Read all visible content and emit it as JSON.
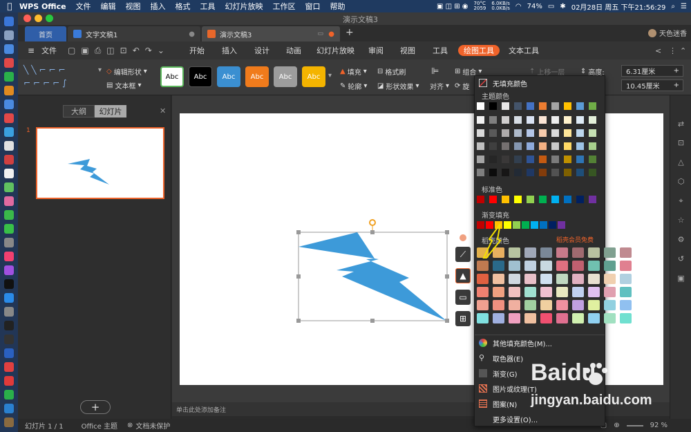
{
  "mac_menubar": {
    "app_name": "WPS Office",
    "items": [
      "文件",
      "编辑",
      "视图",
      "插入",
      "格式",
      "工具",
      "幻灯片放映",
      "工作区",
      "窗口",
      "帮助"
    ],
    "cpu_temp": "70°C",
    "cpu_freq": "2059",
    "net_up": "6.0KB/s",
    "net_down": "0.0KB/s",
    "datetime": "02月28日 周五 下午21:56:29",
    "battery": "74%"
  },
  "window": {
    "title": "演示文稿3",
    "tabs": [
      {
        "label": "首页"
      },
      {
        "label": "文字文稿1"
      },
      {
        "label": "演示文稿3"
      }
    ],
    "add_tab": "+",
    "user_name": "天色迷香"
  },
  "menu_row": {
    "file_label": "文件",
    "tabs": [
      "开始",
      "插入",
      "设计",
      "动画",
      "幻灯片放映",
      "审阅",
      "视图",
      "工具",
      "绘图工具",
      "文本工具"
    ],
    "active_tab": "绘图工具"
  },
  "ribbon": {
    "edit_shape": "编辑形状",
    "text_box": "文本框",
    "style_swatches": [
      {
        "label": "Abc",
        "bg": "#ffffff",
        "fg": "#000000",
        "border": "#5cb85c"
      },
      {
        "label": "Abc",
        "bg": "#000000",
        "fg": "#ffffff",
        "border": "#555555"
      },
      {
        "label": "Abc",
        "bg": "#3b8fd1",
        "fg": "#ffffff",
        "border": "#3b8fd1"
      },
      {
        "label": "Abc",
        "bg": "#f07b1c",
        "fg": "#ffffff",
        "border": "#f07b1c"
      },
      {
        "label": "Abc",
        "bg": "#9d9d9d",
        "fg": "#ffffff",
        "border": "#9d9d9d"
      },
      {
        "label": "Abc",
        "bg": "#f4b400",
        "fg": "#ffffff",
        "border": "#f4b400"
      }
    ],
    "fill": "填充",
    "outline": "轮廓",
    "format_painter": "格式刷",
    "shape_effects": "形状效果",
    "align": "对齐",
    "group": "组合",
    "rotate": "旋",
    "bring_forward": "上移一层",
    "height_label": "高度:",
    "height_value": "6.31厘米",
    "width_value": "10.45厘米"
  },
  "left_panel": {
    "tab_outline": "大纲",
    "tab_slides": "幻灯片",
    "slide_number": "1",
    "add_slide": "+"
  },
  "notes_placeholder": "单击此处添加备注",
  "status_bar": {
    "slide_info": "幻灯片 1 / 1",
    "theme": "Office 主题",
    "protection": "文档未保护",
    "zoom": "92 %"
  },
  "fill_menu": {
    "no_fill": "无填充颜色",
    "theme_colors_label": "主题颜色",
    "theme_row": [
      "#ffffff",
      "#000000",
      "#e7e6e6",
      "#44546a",
      "#4472c4",
      "#ed7d31",
      "#a5a5a5",
      "#ffc000",
      "#5b9bd5",
      "#70ad47"
    ],
    "theme_shades": [
      [
        "#f2f2f2",
        "#7f7f7f",
        "#d0cece",
        "#d6dce4",
        "#d9e2f3",
        "#fbe5d5",
        "#ededed",
        "#fff2cc",
        "#deebf6",
        "#e2efd9"
      ],
      [
        "#d8d8d8",
        "#595959",
        "#aeabab",
        "#adb9ca",
        "#b4c6e7",
        "#f7cbac",
        "#dbdbdb",
        "#fee599",
        "#bdd7ee",
        "#c5e0b3"
      ],
      [
        "#bfbfbf",
        "#3f3f3f",
        "#757070",
        "#8496b0",
        "#8eaadb",
        "#f4b183",
        "#c9c9c9",
        "#ffd965",
        "#9dc3e6",
        "#a8d08d"
      ],
      [
        "#a5a5a5",
        "#262626",
        "#3a3838",
        "#323f4f",
        "#2f5496",
        "#c55a11",
        "#7b7b7b",
        "#bf9000",
        "#2e75b5",
        "#538135"
      ],
      [
        "#7f7f7f",
        "#0c0c0c",
        "#171616",
        "#222a35",
        "#1f3864",
        "#833c0b",
        "#525252",
        "#7f6000",
        "#1e4e79",
        "#375623"
      ]
    ],
    "standard_colors_label": "标准色",
    "standard_colors": [
      "#c00000",
      "#ff0000",
      "#ffc000",
      "#ffff00",
      "#92d050",
      "#00b050",
      "#00b0f0",
      "#0070c0",
      "#002060",
      "#7030a0"
    ],
    "gradient_label": "渐变填充",
    "gradient_colors": [
      "#c00000",
      "#ff0000",
      "#ffc000",
      "#ffff00",
      "#92d050",
      "#00b050",
      "#00b0f0",
      "#0070c0",
      "#002060",
      "#7030a0"
    ],
    "docer_label": "稻壳颜色",
    "docer_promo": "稻壳会员免费",
    "docer_rows": [
      [
        "#e2b04a",
        "#e8b060",
        "#b7c4a0",
        "#a0a8b8",
        "#7a8898",
        "#c77a8a",
        "#a06a70",
        "#b8c0a0",
        "#80a090",
        "#c08a90"
      ],
      [
        "#c07a50",
        "#2a6a8a",
        "#a0c0d0",
        "#c0d0e0",
        "#c8d8e0",
        "#e07080",
        "#c06070",
        "#70c0b0",
        "#60a090",
        "#e08090"
      ],
      [
        "#e06040",
        "#f0c0a0",
        "#d0d8e0",
        "#e8c0c8",
        "#d0e0f0",
        "#c0d8c0",
        "#e0b0c0",
        "#e8e0d0",
        "#f0d0b0",
        "#b0d0e0"
      ],
      [
        "#f08070",
        "#f0a080",
        "#f0c0c0",
        "#a0e0d0",
        "#f0c0d0",
        "#e8e8c0",
        "#c0d0f0",
        "#e0c0f0",
        "#e0a0b0",
        "#60c0c0"
      ],
      [
        "#f0a090",
        "#f09080",
        "#f0b0a0",
        "#a0d0a0",
        "#f0d0a0",
        "#f090a0",
        "#c0a0e0",
        "#e0f0a0",
        "#90d0e0",
        "#90c0f0"
      ],
      [
        "#80e0e0",
        "#a0b0e0",
        "#f0a0c0",
        "#f0c0a0",
        "#f05070",
        "#e07090",
        "#d0f0b0",
        "#90d0f0",
        "#a0e0c0",
        "#70e0d0"
      ]
    ],
    "more_colors": "其他填充颜色(M)...",
    "eyedropper": "取色器(E)",
    "gradient_item": "渐变(G)",
    "picture_texture": "图片或纹理(T)",
    "pattern": "图案(N)",
    "more_settings": "更多设置(O)..."
  },
  "watermark": {
    "brand": "Baidu",
    "sub_brand": "经验",
    "url": "jingyan.baidu.com"
  },
  "colors": {
    "accent": "#f0632a",
    "shape_fill": "#3d9ad9",
    "selection": "#9a9a9a"
  }
}
